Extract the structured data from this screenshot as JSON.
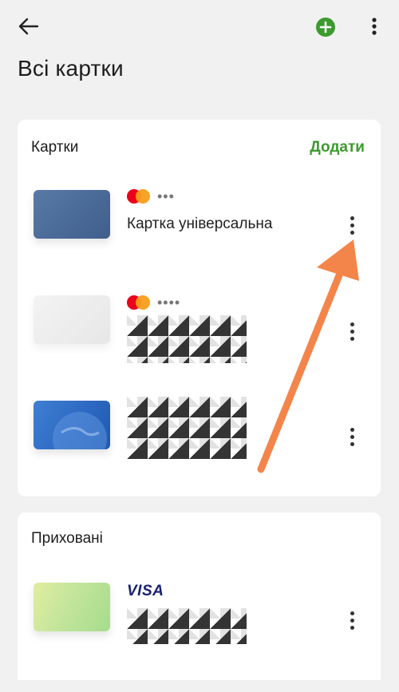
{
  "header": {
    "title": "Всі картки",
    "icons": {
      "back": "arrow-left-icon",
      "add": "plus-circle-icon",
      "more": "more-vertical-icon"
    },
    "accent_color": "#3d9a2f"
  },
  "cards_section": {
    "title": "Картки",
    "add_label": "Додати",
    "cards": [
      {
        "brand": "mastercard",
        "masked": "•••",
        "name": "Картка універсальна"
      },
      {
        "brand": "mastercard",
        "masked": "••••",
        "name": ""
      },
      {
        "brand": "",
        "masked": "",
        "name": ""
      }
    ]
  },
  "hidden_section": {
    "title": "Приховані",
    "cards": [
      {
        "brand": "VISA",
        "masked": "",
        "name": ""
      }
    ]
  },
  "annotation": {
    "arrow_color": "#f4854a"
  }
}
